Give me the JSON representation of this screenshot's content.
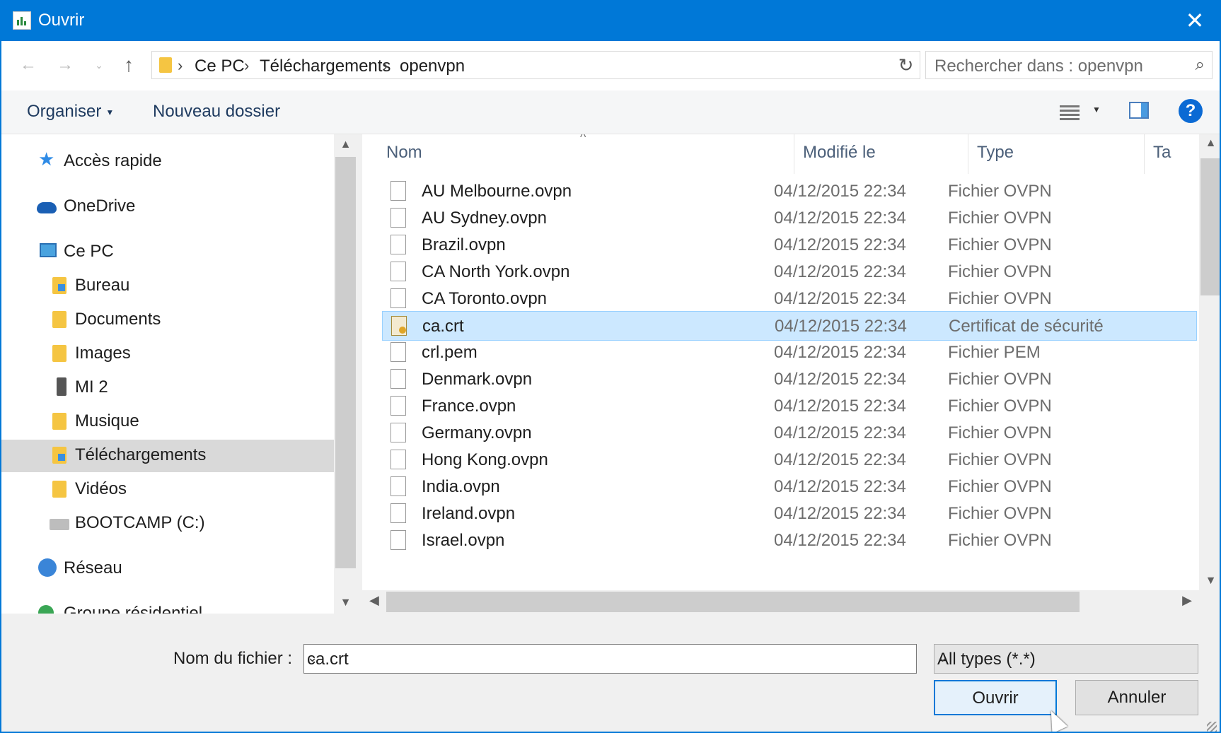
{
  "window": {
    "title": "Ouvrir",
    "close_label": "✕"
  },
  "address": {
    "crumbs": [
      "Ce PC",
      "Téléchargements",
      "openvpn"
    ],
    "search_placeholder": "Rechercher dans : openvpn"
  },
  "toolbar": {
    "organize": "Organiser",
    "new_folder": "Nouveau dossier",
    "help": "?"
  },
  "nav": {
    "items": [
      {
        "label": "Accès rapide",
        "icon": "star-icon"
      },
      {
        "label": "OneDrive",
        "icon": "cloud-icon"
      },
      {
        "label": "Ce PC",
        "icon": "computer-icon"
      },
      {
        "label": "Bureau",
        "icon": "desktop-folder-icon"
      },
      {
        "label": "Documents",
        "icon": "documents-folder-icon"
      },
      {
        "label": "Images",
        "icon": "pictures-folder-icon"
      },
      {
        "label": "MI 2",
        "icon": "phone-icon"
      },
      {
        "label": "Musique",
        "icon": "music-folder-icon"
      },
      {
        "label": "Téléchargements",
        "icon": "downloads-folder-icon",
        "selected": true
      },
      {
        "label": "Vidéos",
        "icon": "videos-folder-icon"
      },
      {
        "label": "BOOTCAMP (C:)",
        "icon": "drive-icon"
      },
      {
        "label": "Réseau",
        "icon": "network-icon"
      },
      {
        "label": "Groupe résidentiel",
        "icon": "homegroup-icon"
      }
    ]
  },
  "columns": {
    "name": "Nom",
    "modified": "Modifié le",
    "type": "Type",
    "size": "Ta"
  },
  "files": [
    {
      "name": "AU Melbourne.ovpn",
      "date": "04/12/2015 22:34",
      "type": "Fichier OVPN"
    },
    {
      "name": "AU Sydney.ovpn",
      "date": "04/12/2015 22:34",
      "type": "Fichier OVPN"
    },
    {
      "name": "Brazil.ovpn",
      "date": "04/12/2015 22:34",
      "type": "Fichier OVPN"
    },
    {
      "name": "CA North York.ovpn",
      "date": "04/12/2015 22:34",
      "type": "Fichier OVPN"
    },
    {
      "name": "CA Toronto.ovpn",
      "date": "04/12/2015 22:34",
      "type": "Fichier OVPN"
    },
    {
      "name": "ca.crt",
      "date": "04/12/2015 22:34",
      "type": "Certificat de sécurité",
      "selected": true
    },
    {
      "name": "crl.pem",
      "date": "04/12/2015 22:34",
      "type": "Fichier PEM"
    },
    {
      "name": "Denmark.ovpn",
      "date": "04/12/2015 22:34",
      "type": "Fichier OVPN"
    },
    {
      "name": "France.ovpn",
      "date": "04/12/2015 22:34",
      "type": "Fichier OVPN"
    },
    {
      "name": "Germany.ovpn",
      "date": "04/12/2015 22:34",
      "type": "Fichier OVPN"
    },
    {
      "name": "Hong Kong.ovpn",
      "date": "04/12/2015 22:34",
      "type": "Fichier OVPN"
    },
    {
      "name": "India.ovpn",
      "date": "04/12/2015 22:34",
      "type": "Fichier OVPN"
    },
    {
      "name": "Ireland.ovpn",
      "date": "04/12/2015 22:34",
      "type": "Fichier OVPN"
    },
    {
      "name": "Israel.ovpn",
      "date": "04/12/2015 22:34",
      "type": "Fichier OVPN"
    }
  ],
  "footer": {
    "filename_label": "Nom du fichier :",
    "filename_value": "ca.crt",
    "filetype_value": "All types (*.*)",
    "open_button": "Ouvrir",
    "cancel_button": "Annuler"
  }
}
